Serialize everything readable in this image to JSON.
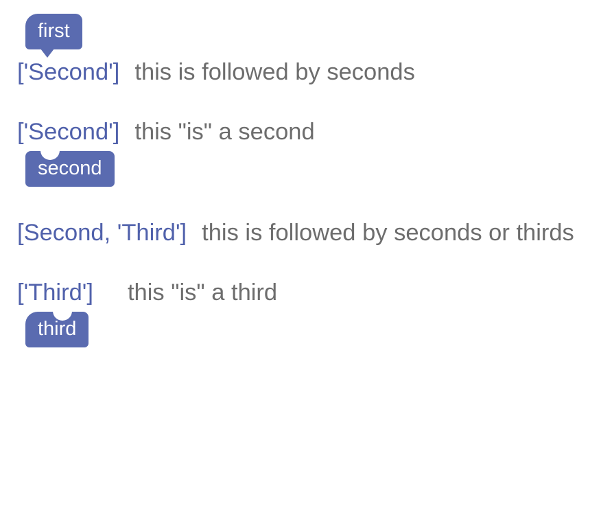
{
  "entries": [
    {
      "block_label": "first",
      "block_style": "hat-arrow",
      "block_above": true,
      "tag": "['Second']",
      "desc": "this is followed by seconds"
    },
    {
      "block_label": "second",
      "block_style": "stack",
      "block_above": false,
      "tag": "['Second']",
      "desc": "this \"is\" a second"
    },
    {
      "block_label": null,
      "block_style": null,
      "block_above": false,
      "tag": "[Second, 'Third']",
      "desc": "this is followed by seconds or thirds"
    },
    {
      "block_label": "third",
      "block_style": "hat-notch",
      "block_above": false,
      "tag": "['Third']",
      "desc": "this \"is\" a third",
      "desc_indent": true
    }
  ]
}
